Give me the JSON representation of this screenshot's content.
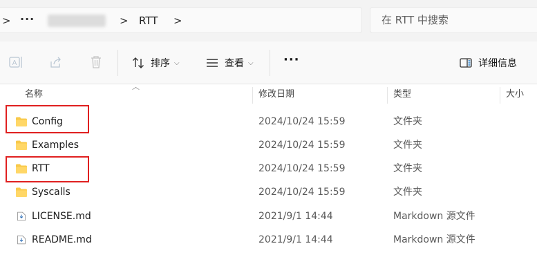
{
  "address_bar": {
    "back_chevron": ">",
    "ellipsis": "···",
    "current_folder": "RTT",
    "trailing_chevron": ">"
  },
  "search": {
    "placeholder": "在 RTT 中搜索"
  },
  "toolbar": {
    "sort_label": "排序",
    "view_label": "查看",
    "more_label": "···",
    "details_label": "详细信息"
  },
  "columns": {
    "name": "名称",
    "date": "修改日期",
    "type": "类型",
    "size": "大小"
  },
  "files": [
    {
      "name": "Config",
      "date": "2024/10/24 15:59",
      "type": "文件夹",
      "icon": "folder-icon"
    },
    {
      "name": "Examples",
      "date": "2024/10/24 15:59",
      "type": "文件夹",
      "icon": "folder-icon"
    },
    {
      "name": "RTT",
      "date": "2024/10/24 15:59",
      "type": "文件夹",
      "icon": "folder-icon"
    },
    {
      "name": "Syscalls",
      "date": "2024/10/24 15:59",
      "type": "文件夹",
      "icon": "folder-icon"
    },
    {
      "name": "LICENSE.md",
      "date": "2021/9/1 14:44",
      "type": "Markdown 源文件",
      "icon": "markdown-file-icon"
    },
    {
      "name": "README.md",
      "date": "2021/9/1 14:44",
      "type": "Markdown 源文件",
      "icon": "markdown-file-icon"
    }
  ],
  "colors": {
    "folder": "#f8c94a",
    "highlight": "#e02020",
    "accent": "#0067c0"
  }
}
